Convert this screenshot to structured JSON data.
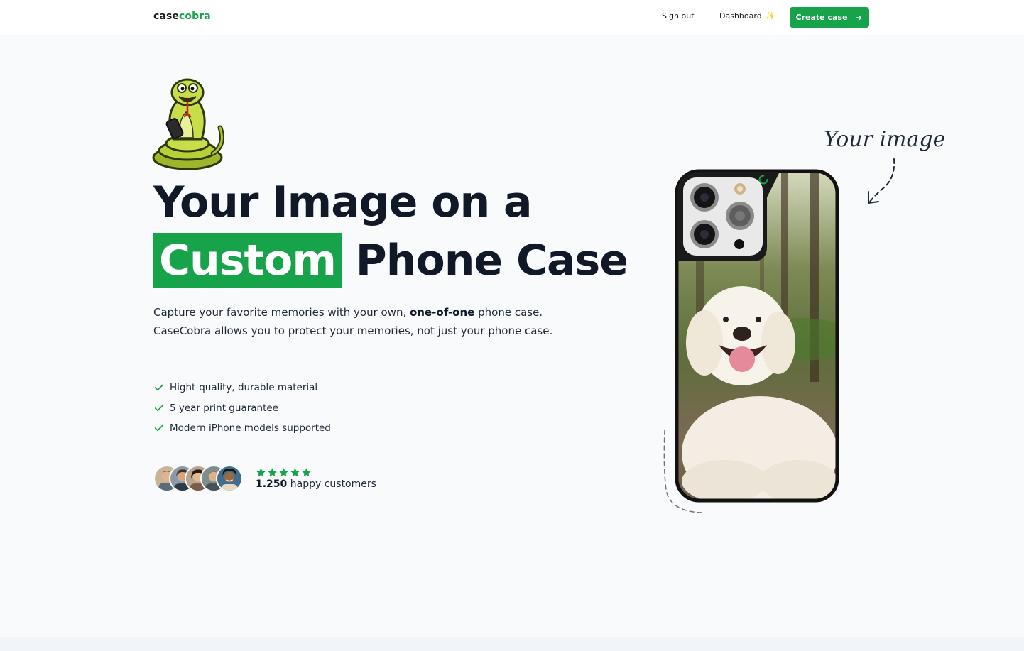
{
  "nav": {
    "logo_prefix": "case",
    "logo_accent": "cobra",
    "sign_out": "Sign out",
    "dashboard": "Dashboard",
    "dashboard_icon": "sparkles-icon",
    "create_case": "Create case",
    "create_case_icon": "arrow-right-icon"
  },
  "hero": {
    "headline_line1": "Your Image on a",
    "headline_highlight": "Custom",
    "headline_rest": "Phone Case",
    "subtext_before": "Capture your favorite memories with your own, ",
    "subtext_bold": "one-of-one",
    "subtext_after": " phone case. CaseCobra allows you to protect your memories, not just your phone case.",
    "features": [
      "Hight-quality, durable material",
      "5 year print guarantee",
      "Modern iPhone models supported"
    ],
    "rating_stars": 5,
    "customers_count": "1.250",
    "customers_label": " happy customers",
    "annotation": "Your image"
  },
  "colors": {
    "brand_green": "#16a34a",
    "text_dark": "#111827",
    "page_bg": "#f8fafc"
  }
}
